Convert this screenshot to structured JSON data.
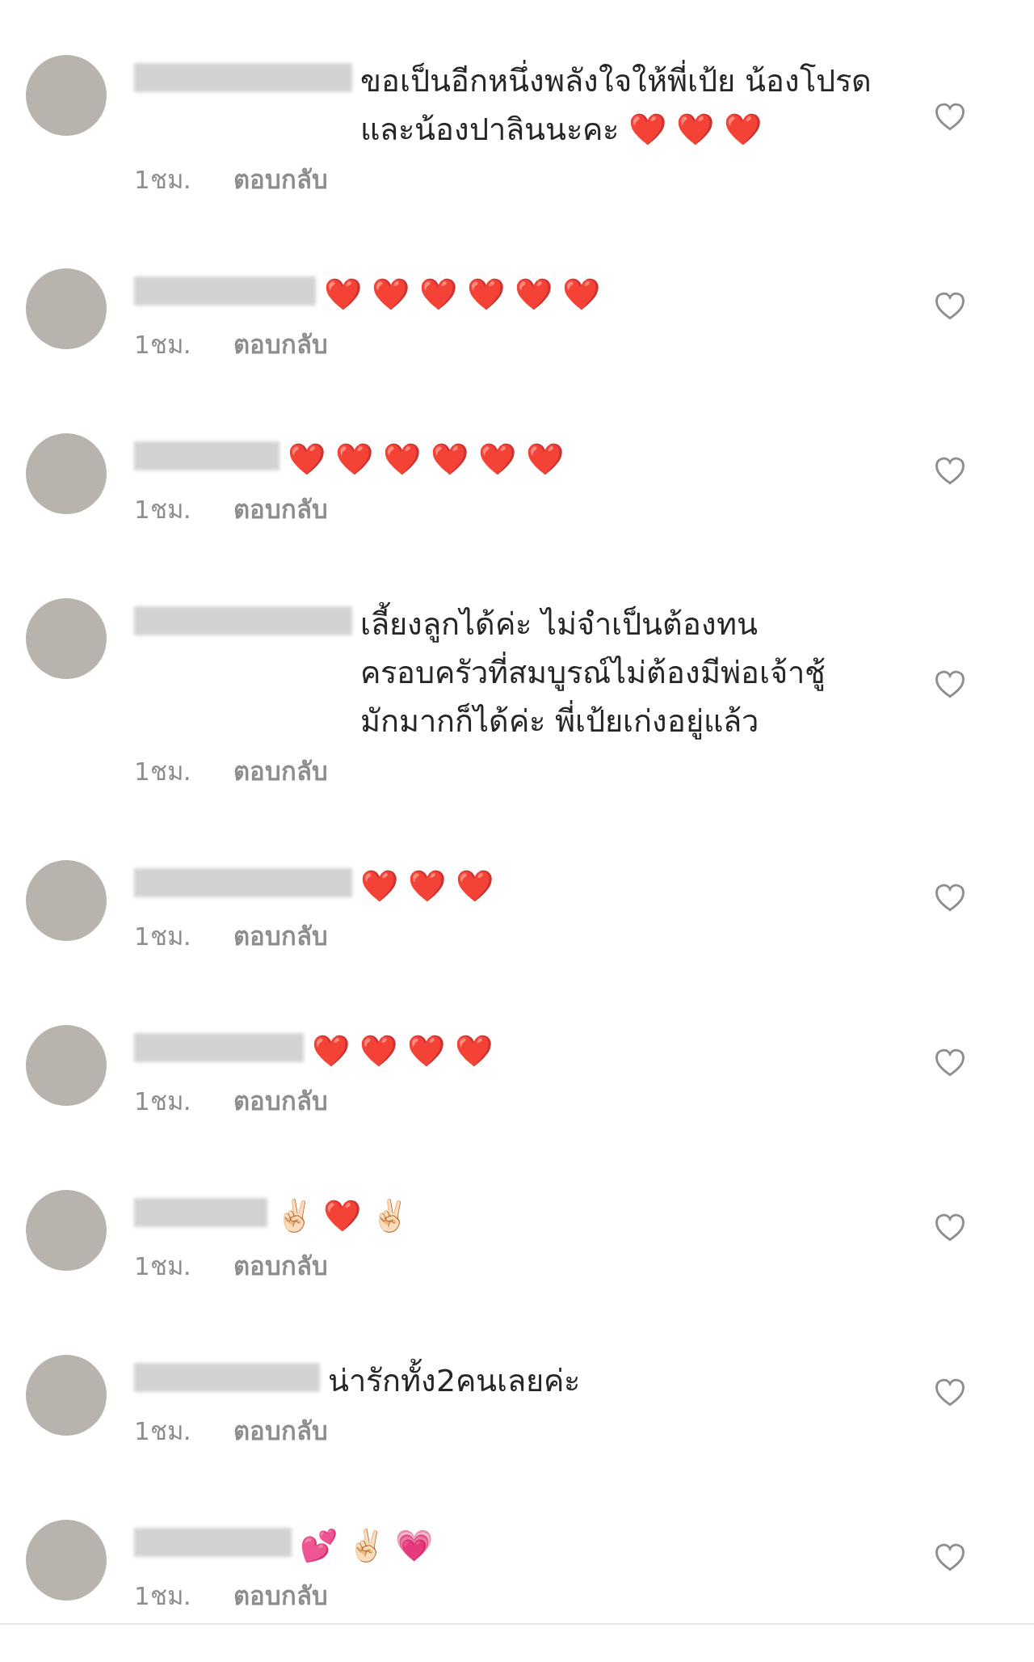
{
  "comments": [
    {
      "text": "ขอเป็นอีกหนึ่งพลังใจให้พี่เป้ย น้องโปรดและน้องปาลินนะคะ ❤️ ❤️ ❤️",
      "time": "1ชม.",
      "reply": "ตอบกลับ"
    },
    {
      "text": "❤️ ❤️ ❤️ ❤️ ❤️ ❤️",
      "time": "1ชม.",
      "reply": "ตอบกลับ"
    },
    {
      "text": "❤️ ❤️ ❤️ ❤️ ❤️ ❤️",
      "time": "1ชม.",
      "reply": "ตอบกลับ"
    },
    {
      "text": "เลี้ยงลูกได้ค่ะ ไม่จำเป็นต้องทน ครอบครัวที่สมบูรณ์ไม่ต้องมีพ่อเจ้าชู้มักมากก็ได้ค่ะ พี่เป้ยเก่งอยู่แล้ว",
      "time": "1ชม.",
      "reply": "ตอบกลับ"
    },
    {
      "text": "❤️ ❤️ ❤️",
      "time": "1ชม.",
      "reply": "ตอบกลับ"
    },
    {
      "text": "❤️ ❤️ ❤️ ❤️",
      "time": "1ชม.",
      "reply": "ตอบกลับ"
    },
    {
      "text": "✌🏻 ❤️ ✌🏻",
      "time": "1ชม.",
      "reply": "ตอบกลับ"
    },
    {
      "text": "น่ารักทั้ง2คนเลยค่ะ",
      "time": "1ชม.",
      "reply": "ตอบกลับ"
    },
    {
      "text": "💕 ✌🏻 💗",
      "time": "1ชม.",
      "reply": "ตอบกลับ"
    }
  ]
}
